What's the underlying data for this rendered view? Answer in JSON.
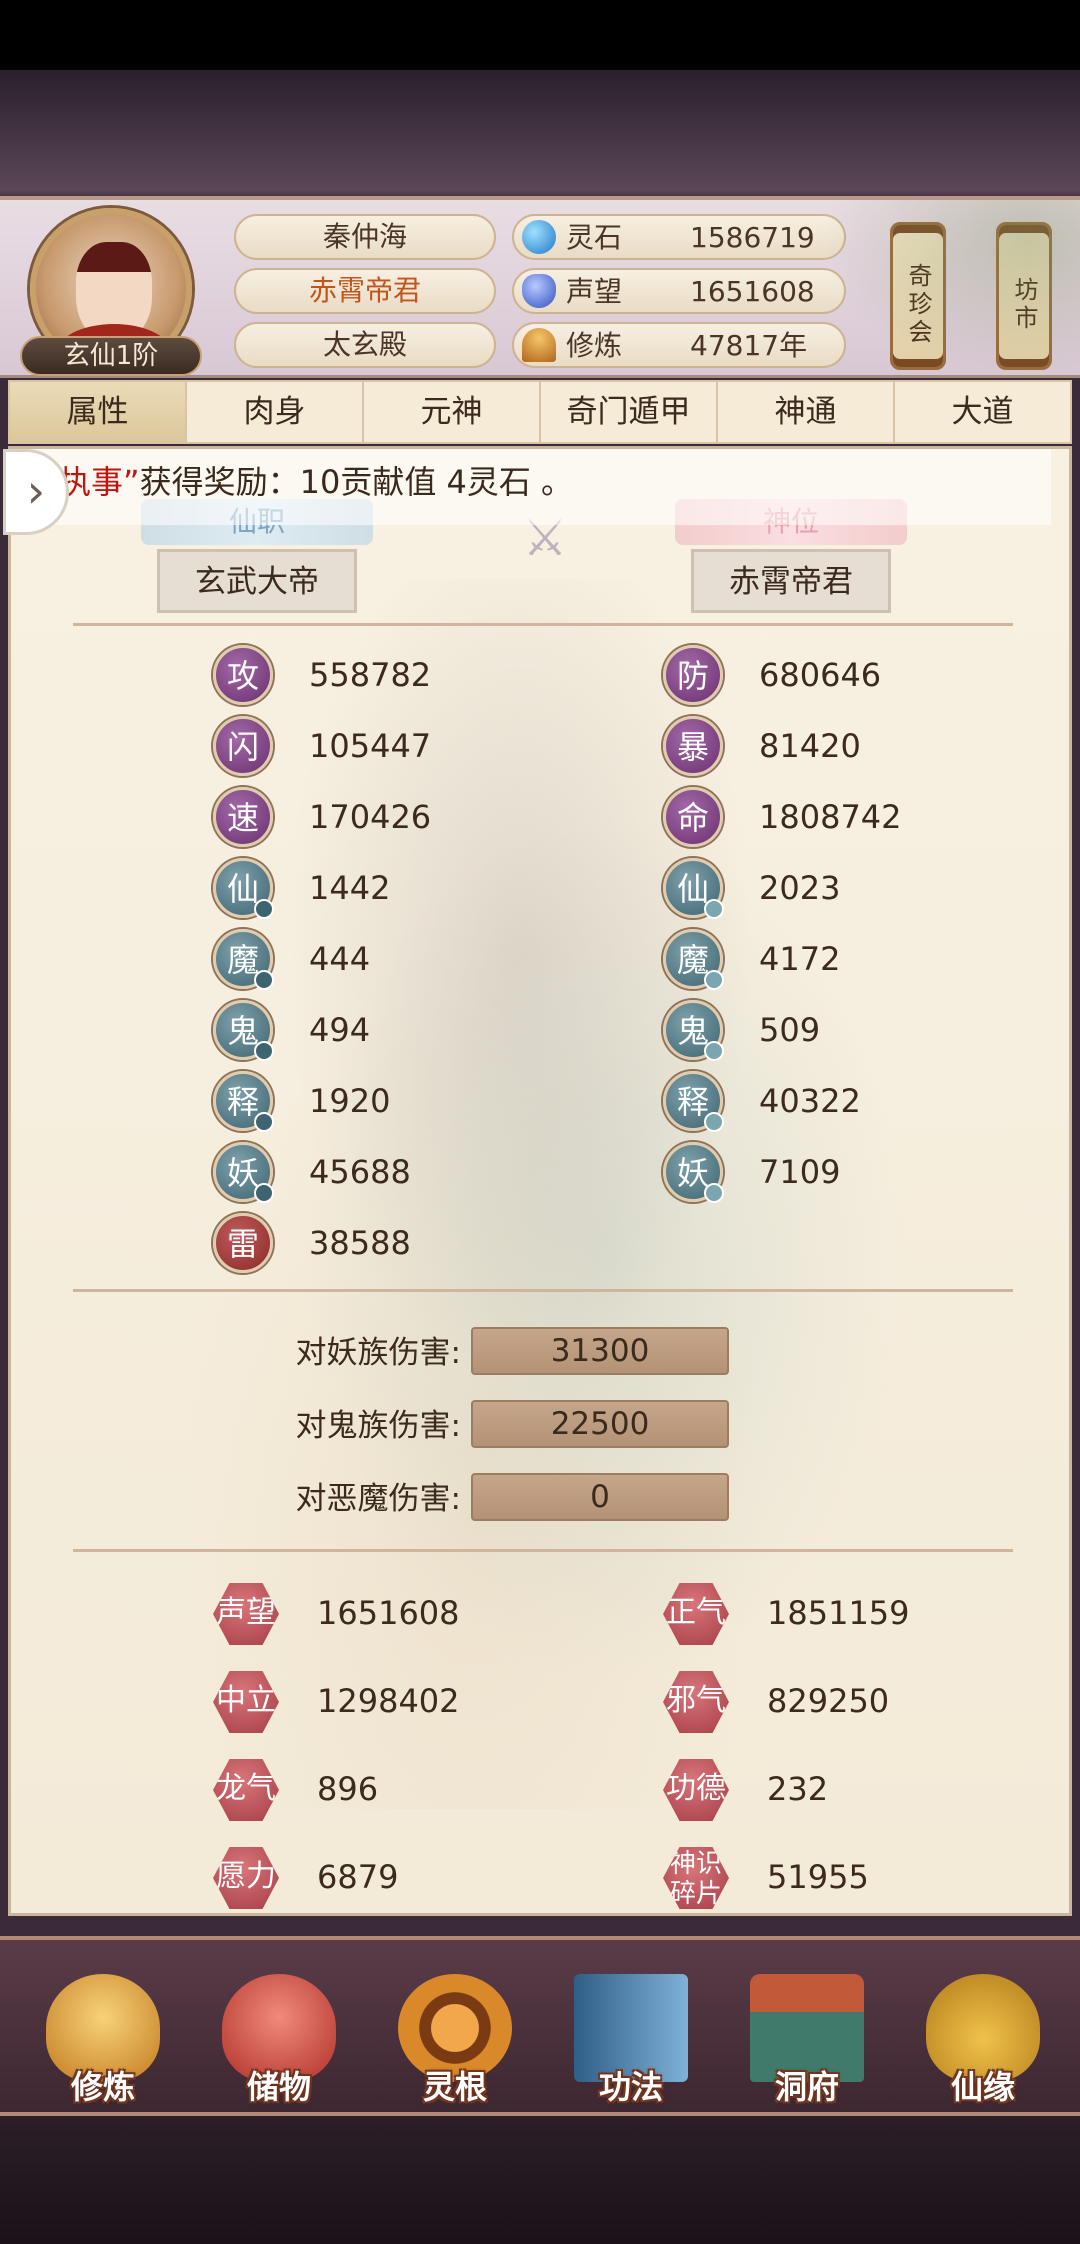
{
  "header": {
    "rank": "玄仙1阶",
    "names": [
      "秦仲海",
      "赤霄帝君",
      "太玄殿"
    ],
    "resources": [
      {
        "name": "灵石",
        "value": "1586719",
        "icon": "gem-icon",
        "color": "#3aa0e0"
      },
      {
        "name": "声望",
        "value": "1651608",
        "icon": "crystal-icon",
        "color": "#4a6fd8"
      },
      {
        "name": "修炼",
        "value": "47817年",
        "icon": "meditation-icon",
        "color": "#c9882a"
      }
    ],
    "side_buttons": [
      "奇珍会",
      "坊市"
    ]
  },
  "tabs": [
    "属性",
    "肉身",
    "元神",
    "奇门遁甲",
    "神通",
    "大道"
  ],
  "notice": {
    "highlight": "执事”",
    "text": "获得奖励：10贡献值 4灵石 。"
  },
  "titles": {
    "left_label": "仙职",
    "left_value": "玄武大帝",
    "right_label": "神位",
    "right_value": "赤霄帝君"
  },
  "stats_left": [
    {
      "char": "攻",
      "value": "558782"
    },
    {
      "char": "闪",
      "value": "105447"
    },
    {
      "char": "速",
      "value": "170426"
    },
    {
      "char": "仙",
      "value": "1442"
    },
    {
      "char": "魔",
      "value": "444"
    },
    {
      "char": "鬼",
      "value": "494"
    },
    {
      "char": "释",
      "value": "1920"
    },
    {
      "char": "妖",
      "value": "45688"
    },
    {
      "char": "雷",
      "value": "38588"
    }
  ],
  "stats_right": [
    {
      "char": "防",
      "value": "680646"
    },
    {
      "char": "暴",
      "value": "81420"
    },
    {
      "char": "命",
      "value": "1808742"
    },
    {
      "char": "仙",
      "value": "2023"
    },
    {
      "char": "魔",
      "value": "4172"
    },
    {
      "char": "鬼",
      "value": "509"
    },
    {
      "char": "释",
      "value": "40322"
    },
    {
      "char": "妖",
      "value": "7109"
    }
  ],
  "damage": [
    {
      "label": "对妖族伤害:",
      "value": "31300"
    },
    {
      "label": "对鬼族伤害:",
      "value": "22500"
    },
    {
      "label": "对恶魔伤害:",
      "value": "0"
    }
  ],
  "reputation_left": [
    {
      "label": "声望",
      "value": "1651608"
    },
    {
      "label": "中立",
      "value": "1298402"
    },
    {
      "label": "龙气",
      "value": "896"
    },
    {
      "label": "愿力",
      "value": "6879"
    }
  ],
  "reputation_right": [
    {
      "label": "正气",
      "value": "1851159"
    },
    {
      "label": "邪气",
      "value": "829250"
    },
    {
      "label": "功德",
      "value": "232"
    },
    {
      "label": "神识碎片",
      "label_line1": "神识",
      "label_line2": "碎片",
      "value": "51955"
    }
  ],
  "bottom_nav": [
    "修炼",
    "储物",
    "灵根",
    "功法",
    "洞府",
    "仙缘"
  ]
}
